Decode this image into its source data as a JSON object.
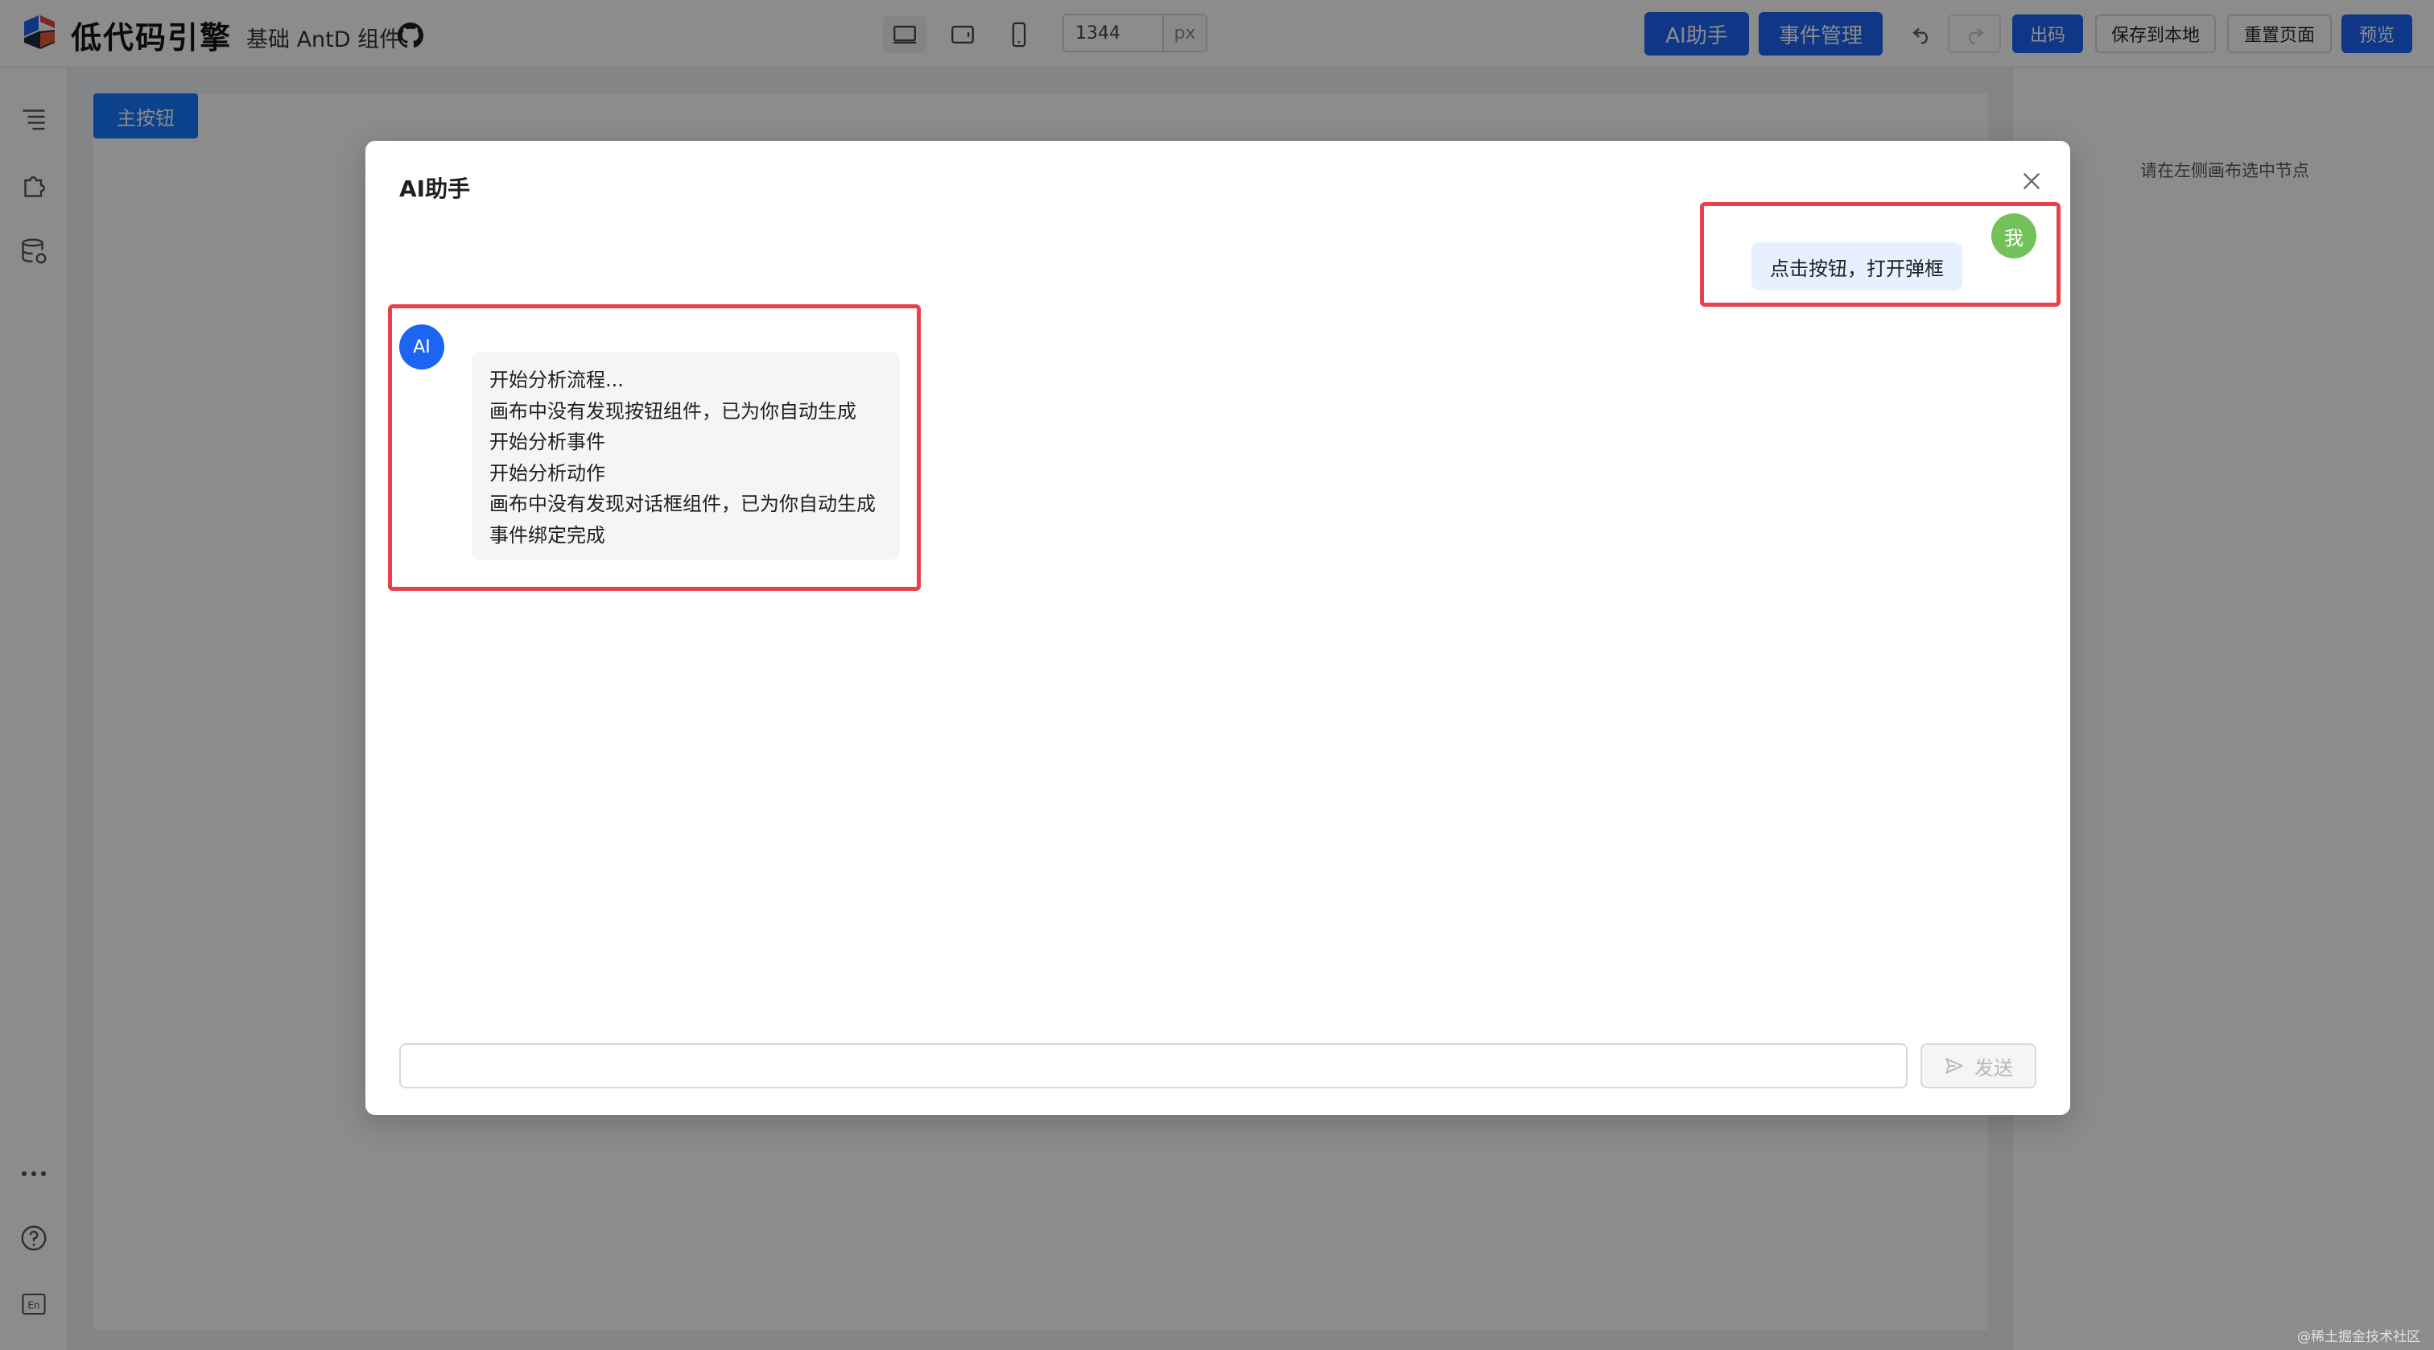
{
  "header": {
    "logo_text": "低代码引擎",
    "subtitle": "基础 AntD 组件",
    "devices": [
      "desktop-icon",
      "tablet-icon",
      "mobile-icon"
    ],
    "canvas_width_value": "1344",
    "canvas_width_unit": "px",
    "ai_assistant_label": "AI助手",
    "event_manage_label": "事件管理",
    "export_code_label": "出码",
    "save_local_label": "保存到本地",
    "reset_page_label": "重置页面",
    "preview_label": "预览"
  },
  "sidebar": {
    "top_icons": [
      "outline-tree-icon",
      "component-puzzle-icon",
      "datasource-icon"
    ],
    "bottom_icons": [
      "more-icon",
      "help-icon",
      "language-icon"
    ]
  },
  "canvas": {
    "button_label": "主按钮"
  },
  "right_panel": {
    "hint": "请在左侧画布选中节点"
  },
  "modal": {
    "title": "AI助手",
    "user_avatar": "我",
    "user_message": "点击按钮，打开弹框",
    "ai_avatar": "AI",
    "ai_lines": [
      "开始分析流程...",
      "画布中没有发现按钮组件，已为你自动生成",
      "开始分析事件",
      "开始分析动作",
      "画布中没有发现对话框组件，已为你自动生成",
      "事件绑定完成"
    ],
    "input_value": "",
    "send_label": "发送"
  },
  "watermark": "@稀土掘金技术社区",
  "colors": {
    "primary": "#1c64f2",
    "highlight": "#e8414a",
    "user_avatar_bg": "#73c15a",
    "ai_avatar_bg": "#1c64f2"
  }
}
